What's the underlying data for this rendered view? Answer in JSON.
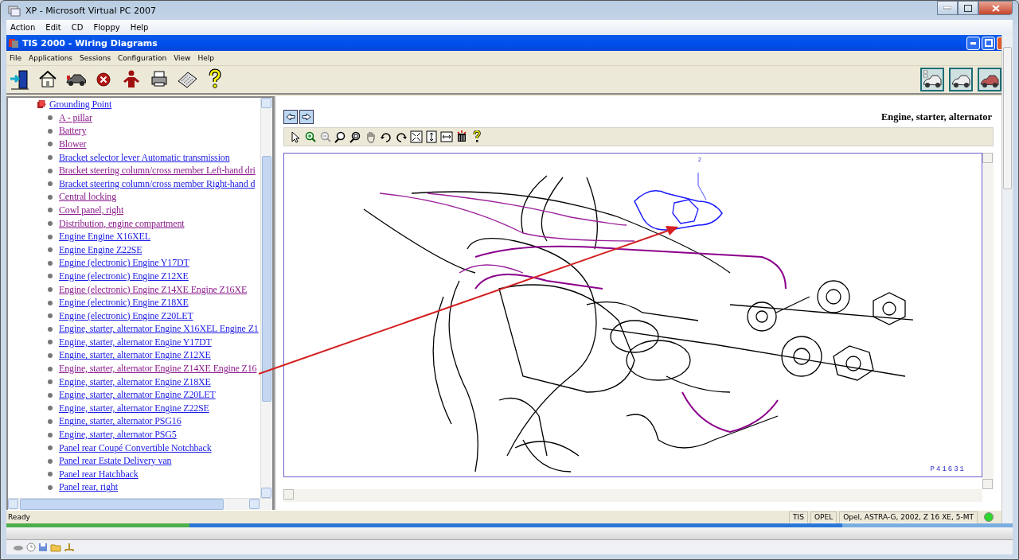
{
  "host_window": {
    "title": "XP - Microsoft Virtual PC 2007",
    "menu": [
      "Action",
      "Edit",
      "CD",
      "Floppy",
      "Help"
    ]
  },
  "app": {
    "title": "TIS 2000 - Wiring Diagrams",
    "menu": [
      "File",
      "Applications",
      "Sessions",
      "Configuration",
      "View",
      "Help"
    ]
  },
  "tree": {
    "label": "Grounding Point",
    "expanded": true,
    "children": [
      {
        "label": "A - pillar",
        "visited": true
      },
      {
        "label": "Battery",
        "visited": true
      },
      {
        "label": "Blower",
        "visited": true
      },
      {
        "label": "Bracket selector lever Automatic transmission",
        "visited": false
      },
      {
        "label": "Bracket steering column/cross member Left-hand dri",
        "visited": true
      },
      {
        "label": "Bracket steering column/cross member Right-hand d",
        "visited": false
      },
      {
        "label": "Central locking",
        "visited": true
      },
      {
        "label": "Cowl panel, right",
        "visited": true
      },
      {
        "label": "Distribution, engine compartment",
        "visited": true
      },
      {
        "label": "Engine Engine X16XEL",
        "visited": false
      },
      {
        "label": "Engine Engine Z22SE",
        "visited": false
      },
      {
        "label": "Engine (electronic) Engine Y17DT",
        "visited": false
      },
      {
        "label": "Engine (electronic) Engine Z12XE",
        "visited": false
      },
      {
        "label": "Engine (electronic) Engine Z14XE Engine Z16XE",
        "visited": true
      },
      {
        "label": "Engine (electronic) Engine Z18XE",
        "visited": false
      },
      {
        "label": "Engine (electronic) Engine Z20LET",
        "visited": false
      },
      {
        "label": "Engine, starter, alternator Engine X16XEL Engine Z1",
        "visited": false
      },
      {
        "label": "Engine, starter, alternator Engine Y17DT",
        "visited": false
      },
      {
        "label": "Engine, starter, alternator Engine Z12XE",
        "visited": false
      },
      {
        "label": "Engine, starter, alternator Engine Z14XE Engine Z16",
        "visited": true
      },
      {
        "label": "Engine, starter, alternator Engine Z18XE",
        "visited": false
      },
      {
        "label": "Engine, starter, alternator Engine Z20LET",
        "visited": false
      },
      {
        "label": "Engine, starter, alternator Engine Z22SE",
        "visited": false
      },
      {
        "label": "Engine, starter, alternator PSG16",
        "visited": false
      },
      {
        "label": "Engine, starter, alternator PSG5",
        "visited": false
      },
      {
        "label": "Panel rear Coupé Convertible Notchback",
        "visited": false
      },
      {
        "label": "Panel rear Estate Delivery van",
        "visited": false
      },
      {
        "label": "Panel rear Hatchback",
        "visited": false
      },
      {
        "label": "Panel rear, right",
        "visited": false
      }
    ]
  },
  "diagram": {
    "title": "Engine, starter, alternator",
    "callout": "2",
    "figure_id": "P41631"
  },
  "status_bar": {
    "message": "Ready",
    "panes": [
      "TIS",
      "OPEL",
      "Opel, ASTRA-G, 2002, Z 16 XE, 5-MT"
    ],
    "connected": true
  }
}
